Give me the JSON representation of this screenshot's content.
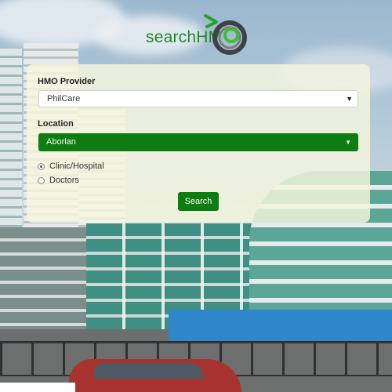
{
  "logo": {
    "text": "searchHM",
    "icon": "hmo-swirl-logo-icon"
  },
  "form": {
    "provider_label": "HMO Provider",
    "provider_value": "PhilCare",
    "location_label": "Location",
    "location_value": "Aborlan",
    "facility_options": [
      {
        "label": "Clinic/Hospital",
        "selected": true
      },
      {
        "label": "Doctors",
        "selected": false
      }
    ],
    "search_label": "Search"
  },
  "colors": {
    "brand_green": "#0e7d11",
    "logo_green": "#22882a",
    "panel_bg": "#f6f6de"
  }
}
